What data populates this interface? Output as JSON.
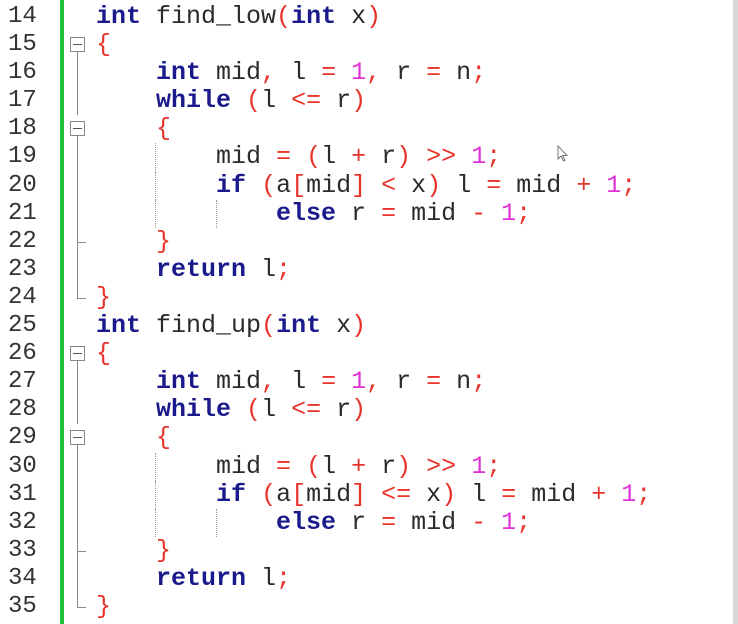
{
  "editor": {
    "colors": {
      "keyword": "#1a1a8c",
      "operator": "#e8332a",
      "number": "#e030d8",
      "identifier": "#2b2b2b",
      "change_bar": "#1fc43a"
    },
    "lines": [
      {
        "num": "14",
        "fold": "none",
        "guides": [],
        "tokens": [
          [
            "kw",
            "int"
          ],
          [
            "id",
            " find_low"
          ],
          [
            "op",
            "("
          ],
          [
            "kw",
            "int"
          ],
          [
            "id",
            " x"
          ],
          [
            "op",
            ")"
          ]
        ]
      },
      {
        "num": "15",
        "fold": "box",
        "guides": [],
        "tokens": [
          [
            "op",
            "{"
          ]
        ]
      },
      {
        "num": "16",
        "fold": "line",
        "guides": [],
        "tokens": [
          [
            "id",
            "    "
          ],
          [
            "kw",
            "int"
          ],
          [
            "id",
            " mid"
          ],
          [
            "op",
            ","
          ],
          [
            "id",
            " l "
          ],
          [
            "op",
            "="
          ],
          [
            "id",
            " "
          ],
          [
            "num",
            "1"
          ],
          [
            "op",
            ","
          ],
          [
            "id",
            " r "
          ],
          [
            "op",
            "="
          ],
          [
            "id",
            " n"
          ],
          [
            "op",
            ";"
          ]
        ]
      },
      {
        "num": "17",
        "fold": "line",
        "guides": [],
        "tokens": [
          [
            "id",
            "    "
          ],
          [
            "kw",
            "while"
          ],
          [
            "id",
            " "
          ],
          [
            "op",
            "("
          ],
          [
            "id",
            "l "
          ],
          [
            "op",
            "<="
          ],
          [
            "id",
            " r"
          ],
          [
            "op",
            ")"
          ]
        ]
      },
      {
        "num": "18",
        "fold": "box",
        "guides": [],
        "tokens": [
          [
            "id",
            "    "
          ],
          [
            "op",
            "{"
          ]
        ]
      },
      {
        "num": "19",
        "fold": "line",
        "guides": [
          4
        ],
        "tokens": [
          [
            "id",
            "        mid "
          ],
          [
            "op",
            "="
          ],
          [
            "id",
            " "
          ],
          [
            "op",
            "("
          ],
          [
            "id",
            "l "
          ],
          [
            "op",
            "+"
          ],
          [
            "id",
            " r"
          ],
          [
            "op",
            ")"
          ],
          [
            "id",
            " "
          ],
          [
            "op",
            ">>"
          ],
          [
            "id",
            " "
          ],
          [
            "num",
            "1"
          ],
          [
            "op",
            ";"
          ]
        ]
      },
      {
        "num": "20",
        "fold": "line",
        "guides": [
          4
        ],
        "tokens": [
          [
            "id",
            "        "
          ],
          [
            "kw",
            "if"
          ],
          [
            "id",
            " "
          ],
          [
            "op",
            "("
          ],
          [
            "id",
            "a"
          ],
          [
            "op",
            "["
          ],
          [
            "id",
            "mid"
          ],
          [
            "op",
            "]"
          ],
          [
            "id",
            " "
          ],
          [
            "op",
            "<"
          ],
          [
            "id",
            " x"
          ],
          [
            "op",
            ")"
          ],
          [
            "id",
            " l "
          ],
          [
            "op",
            "="
          ],
          [
            "id",
            " mid "
          ],
          [
            "op",
            "+"
          ],
          [
            "id",
            " "
          ],
          [
            "num",
            "1"
          ],
          [
            "op",
            ";"
          ]
        ]
      },
      {
        "num": "21",
        "fold": "line",
        "guides": [
          4,
          8
        ],
        "tokens": [
          [
            "id",
            "            "
          ],
          [
            "kw",
            "else"
          ],
          [
            "id",
            " r "
          ],
          [
            "op",
            "="
          ],
          [
            "id",
            " mid "
          ],
          [
            "op",
            "-"
          ],
          [
            "id",
            " "
          ],
          [
            "num",
            "1"
          ],
          [
            "op",
            ";"
          ]
        ]
      },
      {
        "num": "22",
        "fold": "branch",
        "guides": [],
        "tokens": [
          [
            "id",
            "    "
          ],
          [
            "op",
            "}"
          ]
        ]
      },
      {
        "num": "23",
        "fold": "line",
        "guides": [],
        "tokens": [
          [
            "id",
            "    "
          ],
          [
            "kw",
            "return"
          ],
          [
            "id",
            " l"
          ],
          [
            "op",
            ";"
          ]
        ]
      },
      {
        "num": "24",
        "fold": "end",
        "guides": [],
        "tokens": [
          [
            "op",
            "}"
          ]
        ]
      },
      {
        "num": "25",
        "fold": "none",
        "guides": [],
        "tokens": [
          [
            "kw",
            "int"
          ],
          [
            "id",
            " find_up"
          ],
          [
            "op",
            "("
          ],
          [
            "kw",
            "int"
          ],
          [
            "id",
            " x"
          ],
          [
            "op",
            ")"
          ]
        ]
      },
      {
        "num": "26",
        "fold": "box",
        "guides": [],
        "tokens": [
          [
            "op",
            "{"
          ]
        ]
      },
      {
        "num": "27",
        "fold": "line",
        "guides": [],
        "tokens": [
          [
            "id",
            "    "
          ],
          [
            "kw",
            "int"
          ],
          [
            "id",
            " mid"
          ],
          [
            "op",
            ","
          ],
          [
            "id",
            " l "
          ],
          [
            "op",
            "="
          ],
          [
            "id",
            " "
          ],
          [
            "num",
            "1"
          ],
          [
            "op",
            ","
          ],
          [
            "id",
            " r "
          ],
          [
            "op",
            "="
          ],
          [
            "id",
            " n"
          ],
          [
            "op",
            ";"
          ]
        ]
      },
      {
        "num": "28",
        "fold": "line",
        "guides": [],
        "tokens": [
          [
            "id",
            "    "
          ],
          [
            "kw",
            "while"
          ],
          [
            "id",
            " "
          ],
          [
            "op",
            "("
          ],
          [
            "id",
            "l "
          ],
          [
            "op",
            "<="
          ],
          [
            "id",
            " r"
          ],
          [
            "op",
            ")"
          ]
        ]
      },
      {
        "num": "29",
        "fold": "box",
        "guides": [],
        "tokens": [
          [
            "id",
            "    "
          ],
          [
            "op",
            "{"
          ]
        ]
      },
      {
        "num": "30",
        "fold": "line",
        "guides": [
          4
        ],
        "tokens": [
          [
            "id",
            "        mid "
          ],
          [
            "op",
            "="
          ],
          [
            "id",
            " "
          ],
          [
            "op",
            "("
          ],
          [
            "id",
            "l "
          ],
          [
            "op",
            "+"
          ],
          [
            "id",
            " r"
          ],
          [
            "op",
            ")"
          ],
          [
            "id",
            " "
          ],
          [
            "op",
            ">>"
          ],
          [
            "id",
            " "
          ],
          [
            "num",
            "1"
          ],
          [
            "op",
            ";"
          ]
        ]
      },
      {
        "num": "31",
        "fold": "line",
        "guides": [
          4
        ],
        "tokens": [
          [
            "id",
            "        "
          ],
          [
            "kw",
            "if"
          ],
          [
            "id",
            " "
          ],
          [
            "op",
            "("
          ],
          [
            "id",
            "a"
          ],
          [
            "op",
            "["
          ],
          [
            "id",
            "mid"
          ],
          [
            "op",
            "]"
          ],
          [
            "id",
            " "
          ],
          [
            "op",
            "<="
          ],
          [
            "id",
            " x"
          ],
          [
            "op",
            ")"
          ],
          [
            "id",
            " l "
          ],
          [
            "op",
            "="
          ],
          [
            "id",
            " mid "
          ],
          [
            "op",
            "+"
          ],
          [
            "id",
            " "
          ],
          [
            "num",
            "1"
          ],
          [
            "op",
            ";"
          ]
        ]
      },
      {
        "num": "32",
        "fold": "line",
        "guides": [
          4,
          8
        ],
        "tokens": [
          [
            "id",
            "            "
          ],
          [
            "kw",
            "else"
          ],
          [
            "id",
            " r "
          ],
          [
            "op",
            "="
          ],
          [
            "id",
            " mid "
          ],
          [
            "op",
            "-"
          ],
          [
            "id",
            " "
          ],
          [
            "num",
            "1"
          ],
          [
            "op",
            ";"
          ]
        ]
      },
      {
        "num": "33",
        "fold": "branch",
        "guides": [],
        "tokens": [
          [
            "id",
            "    "
          ],
          [
            "op",
            "}"
          ]
        ]
      },
      {
        "num": "34",
        "fold": "line",
        "guides": [],
        "tokens": [
          [
            "id",
            "    "
          ],
          [
            "kw",
            "return"
          ],
          [
            "id",
            " l"
          ],
          [
            "op",
            ";"
          ]
        ]
      },
      {
        "num": "35",
        "fold": "end",
        "guides": [],
        "tokens": [
          [
            "op",
            "}"
          ]
        ]
      }
    ]
  }
}
